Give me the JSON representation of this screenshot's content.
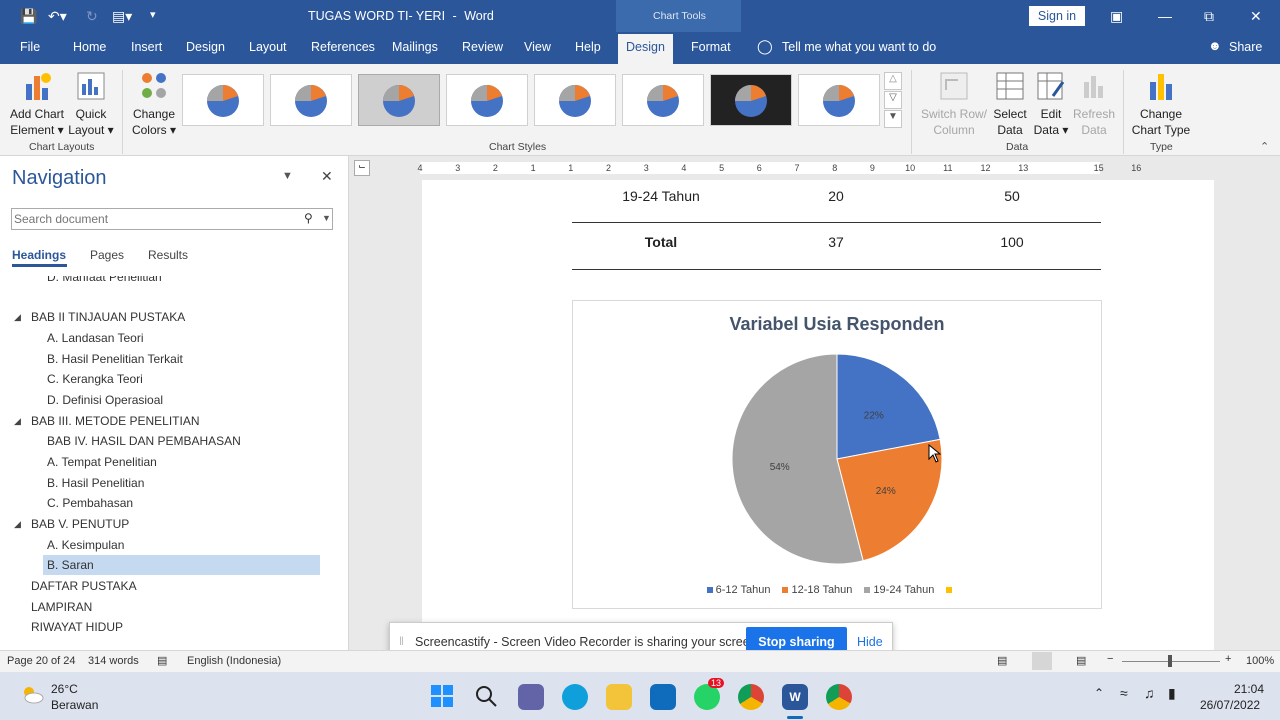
{
  "titlebar": {
    "doc_title": "TUGAS WORD TI- YERI",
    "separator": "-",
    "app_name": "Word",
    "context_tab": "Chart Tools",
    "sign_in": "Sign in"
  },
  "tabs": [
    "File",
    "Home",
    "Insert",
    "Design",
    "Layout",
    "References",
    "Mailings",
    "Review",
    "View",
    "Help",
    "Design",
    "Format"
  ],
  "tell_me": "Tell me what you want to do",
  "share": "Share",
  "ribbon": {
    "add_chart": [
      "Add Chart",
      "Element ▾"
    ],
    "quick_layout": [
      "Quick",
      "Layout ▾"
    ],
    "chart_layouts": "Chart Layouts",
    "change_colors": [
      "Change",
      "Colors ▾"
    ],
    "chart_styles": "Chart Styles",
    "switch": [
      "Switch Row/",
      "Column"
    ],
    "select_data": [
      "Select",
      "Data"
    ],
    "edit_data": [
      "Edit",
      "Data ▾"
    ],
    "refresh_data": [
      "Refresh",
      "Data"
    ],
    "data_group": "Data",
    "change_type": [
      "Change",
      "Chart Type"
    ],
    "type_group": "Type"
  },
  "nav": {
    "title": "Navigation",
    "search_placeholder": "Search document",
    "tabs": [
      "Headings",
      "Pages",
      "Results"
    ],
    "items": [
      "D. Manfaat Penelitian",
      "BAB II  TINJAUAN PUSTAKA",
      "A. Landasan Teori",
      "B. Hasil Penelitian Terkait",
      "C. Kerangka Teori",
      "D. Definisi Operasioal",
      "BAB III.  METODE PENELITIAN",
      "BAB IV.  HASIL DAN PEMBAHASAN",
      "A. Tempat Penelitian",
      "B. Hasil Penelitian",
      "C. Pembahasan",
      "BAB V.  PENUTUP",
      "A. Kesimpulan",
      "B. Saran",
      "DAFTAR PUSTAKA",
      "LAMPIRAN",
      "RIWAYAT HIDUP"
    ]
  },
  "ruler": {
    "ticks": [
      "4",
      "3",
      "2",
      "1",
      "1",
      "2",
      "3",
      "4",
      "5",
      "6",
      "7",
      "8",
      "9",
      "10",
      "11",
      "12",
      "13",
      "15",
      "16"
    ]
  },
  "table": {
    "rows": [
      [
        "19-24 Tahun",
        "20",
        "50"
      ],
      [
        "Total",
        "37",
        "100"
      ]
    ]
  },
  "chart_data": {
    "type": "pie",
    "title": "Variabel Usia Responden",
    "categories": [
      "6-12 Tahun",
      "12-18 Tahun",
      "19-24 Tahun",
      ""
    ],
    "values": [
      22,
      24,
      54,
      0
    ],
    "labels": [
      "22%",
      "24%",
      "54%"
    ],
    "colors": [
      "#4472c4",
      "#ed7d31",
      "#a5a5a5",
      "#ffc000"
    ],
    "legend_position": "bottom"
  },
  "share_bar": {
    "message": "Screencastify - Screen Video Recorder is sharing your screen.",
    "stop": "Stop sharing",
    "hide": "Hide"
  },
  "status": {
    "page": "Page 20 of 24",
    "words": "314 words",
    "language": "English (Indonesia)",
    "zoom": "100%"
  },
  "taskbar": {
    "temp": "26°C",
    "weather": "Berawan",
    "time": "21:04",
    "date": "26/07/2022",
    "badge": "13"
  }
}
